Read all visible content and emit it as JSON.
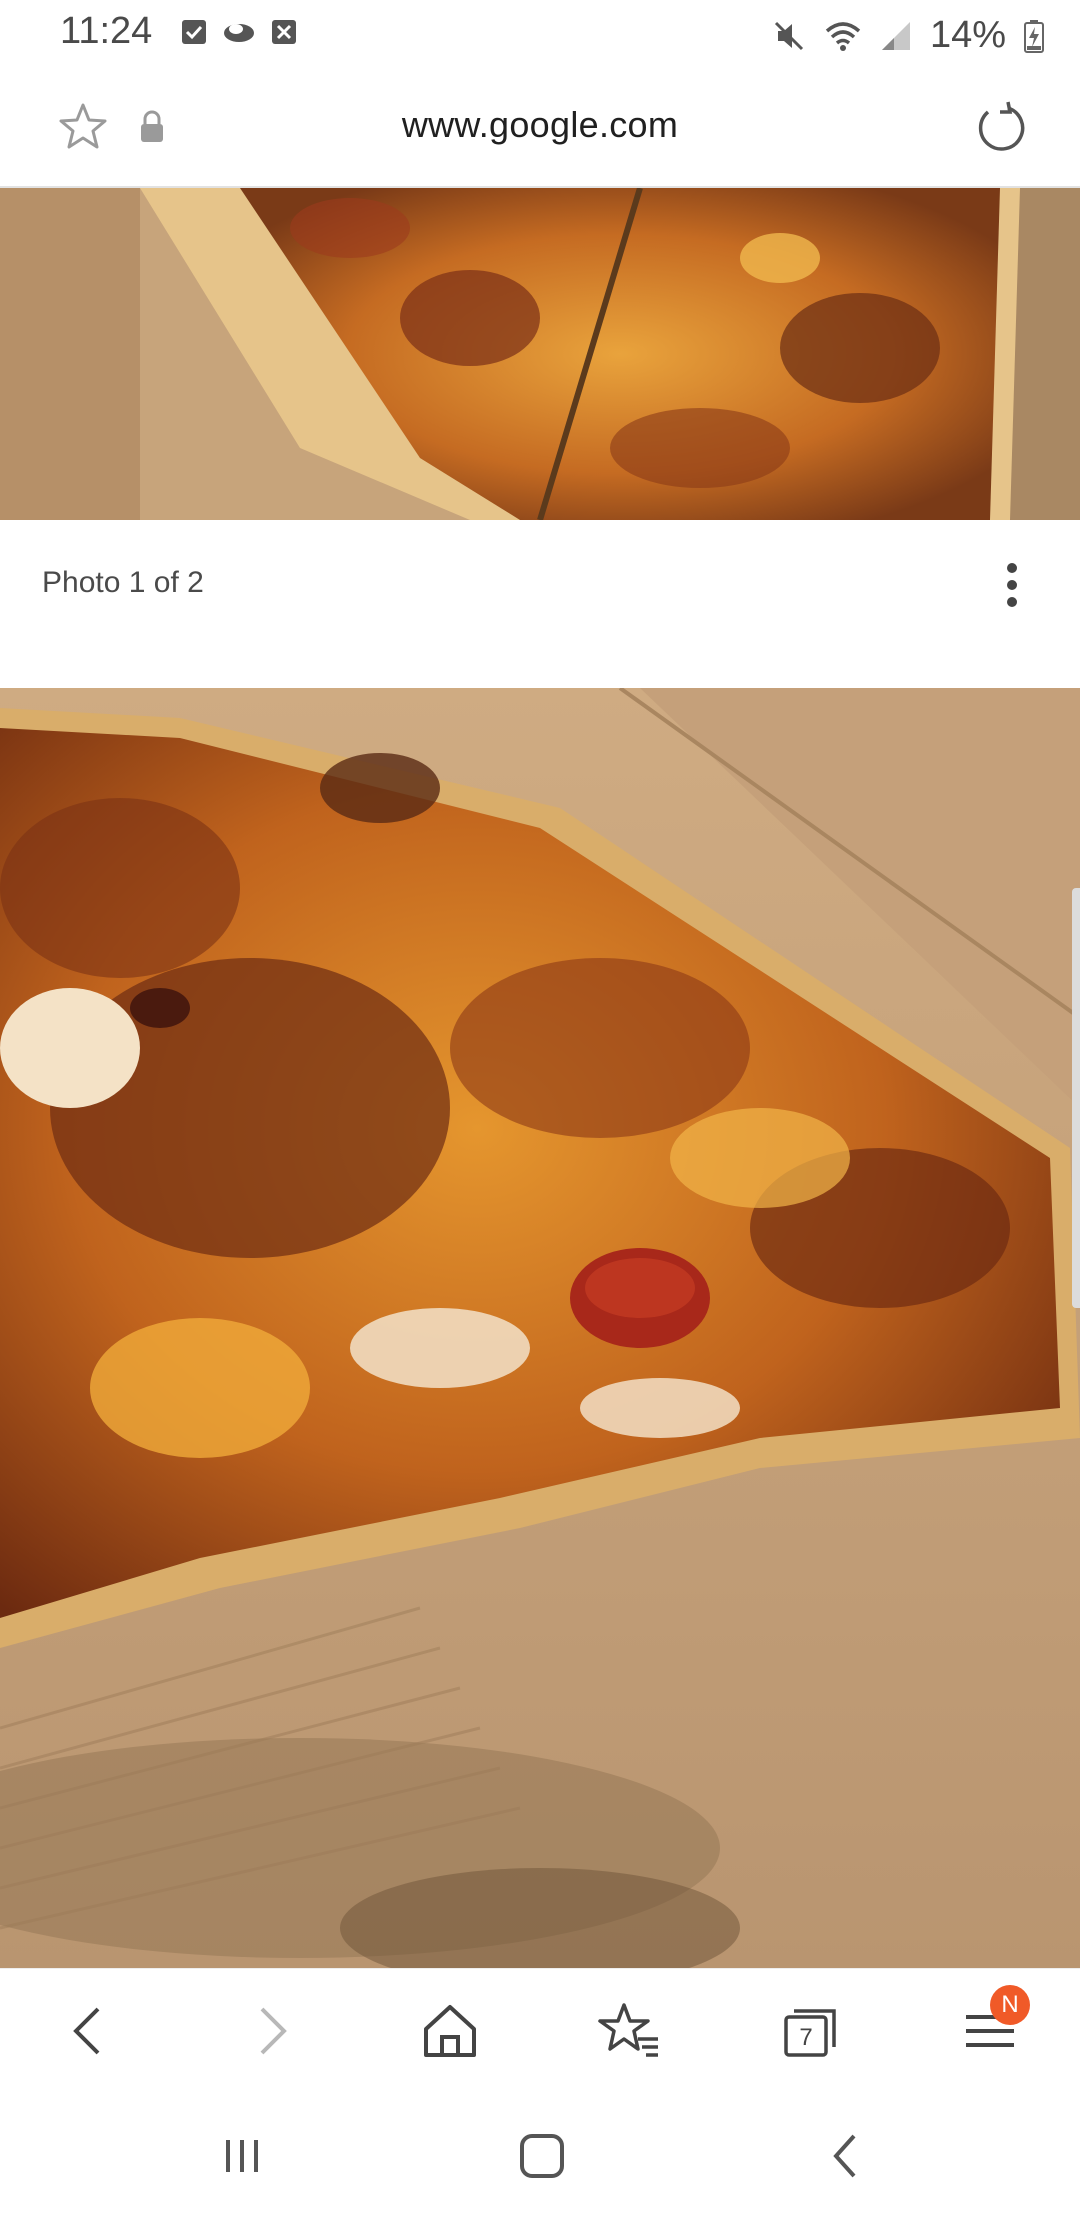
{
  "status_bar": {
    "time": "11:24",
    "battery": "14%",
    "notification_icons": [
      "checkbox-icon",
      "cloud-icon",
      "close-box-icon"
    ],
    "system_icons": [
      "mute-icon",
      "wifi-icon",
      "signal-icon",
      "battery-charging-icon"
    ]
  },
  "url_bar": {
    "url": "www.google.com",
    "icons": [
      "star-icon",
      "lock-icon",
      "reload-icon"
    ]
  },
  "gallery": {
    "caption": "Photo 1 of 2"
  },
  "toolbar": {
    "tab_count": "7",
    "menu_badge": "N",
    "icons": [
      "back-icon",
      "forward-icon",
      "home-icon",
      "bookmarks-icon",
      "tabs-icon",
      "menu-icon"
    ]
  },
  "system_nav": {
    "icons": [
      "recent-apps-icon",
      "home-button-icon",
      "system-back-icon"
    ]
  },
  "colors": {
    "badge": "#f05a28",
    "box_cardboard": "#c9a47a",
    "cheese": "#e8a23a"
  }
}
